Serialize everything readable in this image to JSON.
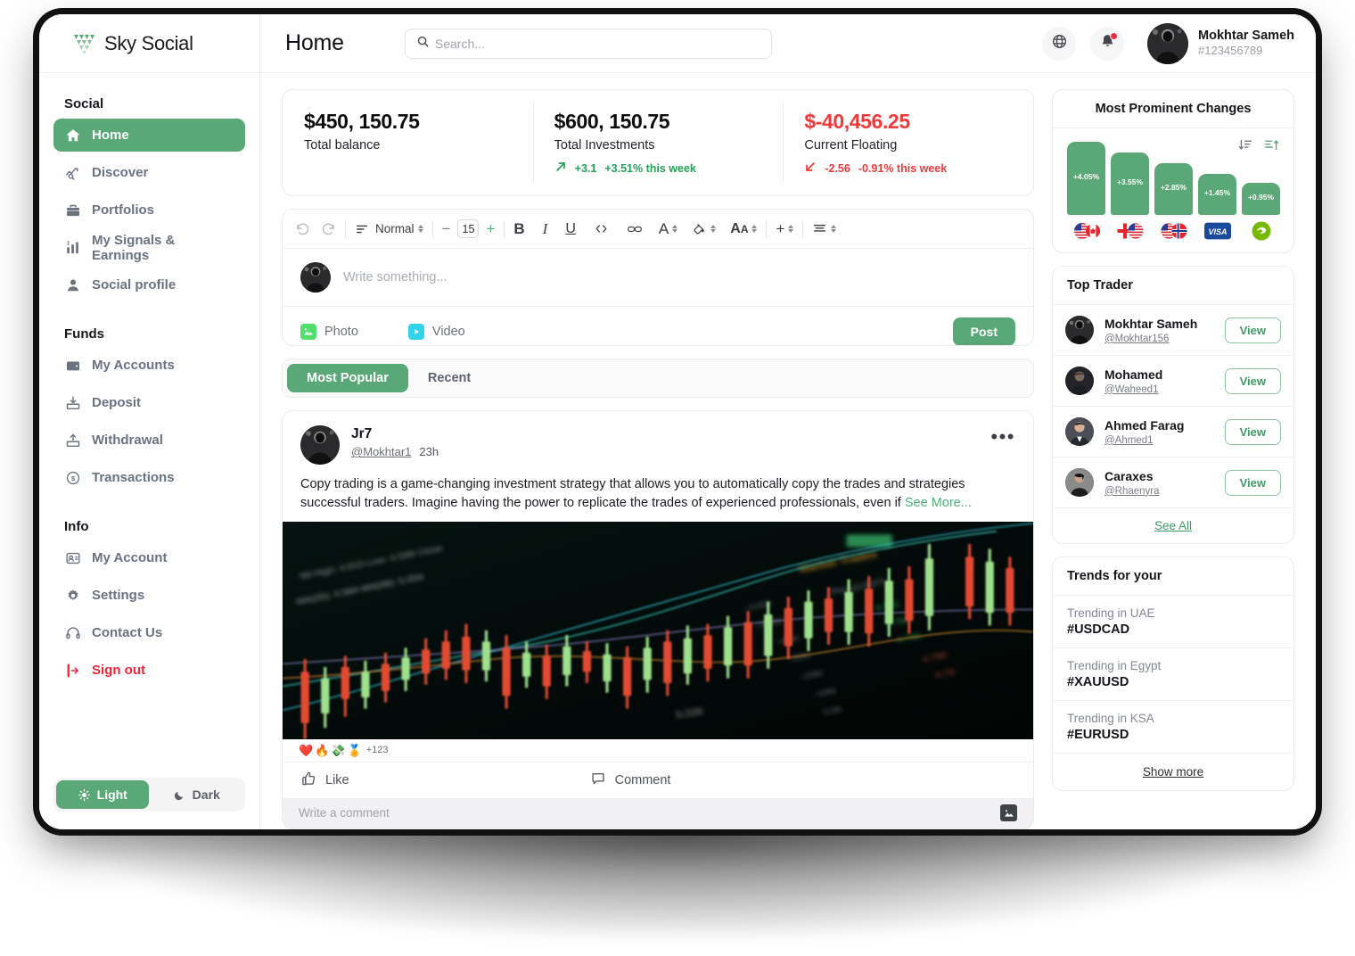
{
  "brand": {
    "name": "Sky Social"
  },
  "header": {
    "title": "Home",
    "search_placeholder": "Search...",
    "user_name": "Mokhtar Sameh",
    "user_id": "#123456789"
  },
  "sidebar": {
    "groups": [
      {
        "title": "Social",
        "items": [
          {
            "label": "Home",
            "icon": "home-icon",
            "active": true
          },
          {
            "label": "Discover",
            "icon": "discover-icon"
          },
          {
            "label": "Portfolios",
            "icon": "briefcase-icon"
          },
          {
            "label": "My Signals & Earnings",
            "icon": "bar-chart-icon"
          },
          {
            "label": "Social profile",
            "icon": "person-icon"
          }
        ]
      },
      {
        "title": "Funds",
        "items": [
          {
            "label": "My Accounts",
            "icon": "wallet-icon"
          },
          {
            "label": "Deposit",
            "icon": "deposit-icon"
          },
          {
            "label": "Withdrawal",
            "icon": "withdrawal-icon"
          },
          {
            "label": "Transactions",
            "icon": "transactions-icon"
          }
        ]
      },
      {
        "title": "Info",
        "items": [
          {
            "label": "My Account",
            "icon": "account-card-icon"
          },
          {
            "label": "Settings",
            "icon": "gear-icon"
          },
          {
            "label": "Contact Us",
            "icon": "headset-icon"
          },
          {
            "label": "Sign out",
            "icon": "sign-out-icon",
            "danger": true
          }
        ]
      }
    ],
    "theme": {
      "light_label": "Light",
      "dark_label": "Dark",
      "selected": "Light"
    }
  },
  "stats": [
    {
      "value": "$450, 150.75",
      "label": "Total balance",
      "negative": false,
      "delta": null
    },
    {
      "value": "$600, 150.75",
      "label": "Total Investments",
      "negative": false,
      "delta": {
        "direction": "up",
        "amount": "+3.1",
        "percent": "+3.51% this week"
      }
    },
    {
      "value": "$-40,456.25",
      "label": "Current Floating",
      "negative": true,
      "delta": {
        "direction": "down",
        "amount": "-2.56",
        "percent": "-0.91% this week"
      }
    }
  ],
  "editor": {
    "paragraph_style": "Normal",
    "font_size": "15",
    "tools": [
      "undo-icon",
      "redo-icon",
      "paragraph-icon",
      "decrease-font",
      "increase-font",
      "bold-icon",
      "italic-icon",
      "underline-icon",
      "code-icon",
      "link-icon",
      "text-color-icon",
      "fill-color-icon",
      "font-case-icon",
      "insert-icon",
      "align-icon"
    ]
  },
  "composer": {
    "placeholder": "Write something...",
    "photo_label": "Photo",
    "video_label": "Video",
    "post_label": "Post"
  },
  "tabs": [
    {
      "label": "Most Popular",
      "active": true
    },
    {
      "label": "Recent",
      "active": false
    }
  ],
  "post": {
    "author": "Jr7",
    "handle": "@Mokhtar1",
    "time": "23h",
    "text": "Copy trading is a game-changing investment strategy that allows you to automatically copy the trades and strategies successful traders. Imagine having the power to replicate the trades of experienced professionals, even if ",
    "see_more": "See More...",
    "image_alt": "candlestick-trading-chart-photo",
    "reactions": [
      "❤️",
      "🔥",
      "💸",
      "🏅"
    ],
    "reaction_count": "+123",
    "like_label": "Like",
    "comment_label": "Comment",
    "comment_placeholder": "Write a comment"
  },
  "changes_panel": {
    "title": "Most Prominent Changes",
    "sort_desc_icon": "sort-descending-icon",
    "sort_asc_icon": "sort-ascending-icon"
  },
  "chart_data": {
    "type": "bar",
    "title": "Most Prominent Changes",
    "categories": [
      "USD/CAD",
      "GBP/USD",
      "USD/NOK",
      "VISA",
      "NVIDIA"
    ],
    "values": [
      4.05,
      3.55,
      2.85,
      1.45,
      0.95
    ],
    "data_labels": [
      "+4.05%",
      "+3.55%",
      "+2.85%",
      "+1.45%",
      "+0.95%"
    ],
    "icons": [
      "flag-us-ca",
      "flag-gb-us",
      "flag-us-no",
      "visa-card",
      "nvidia-logo"
    ],
    "ylim": [
      0,
      4.5
    ],
    "xlabel": "",
    "ylabel": "",
    "grid": false,
    "legend": "none",
    "bar_color": "#5aa877"
  },
  "top_trader": {
    "title": "Top Trader",
    "see_all_label": "See All",
    "view_label": "View",
    "traders": [
      {
        "name": "Mokhtar Sameh",
        "handle": "@Mokhtar156"
      },
      {
        "name": "Mohamed",
        "handle": "@Waheed1"
      },
      {
        "name": "Ahmed Farag",
        "handle": "@Ahmed1"
      },
      {
        "name": "Caraxes",
        "handle": "@Rhaenyra"
      }
    ]
  },
  "trends": {
    "title": "Trends for your",
    "show_more_label": "Show more",
    "items": [
      {
        "region": "Trending in UAE",
        "tag": "#USDCAD"
      },
      {
        "region": "Trending in Egypt",
        "tag": "#XAUUSD"
      },
      {
        "region": "Trending in KSA",
        "tag": "#EURUSD"
      }
    ]
  },
  "colors": {
    "accent_green": "#5aa877",
    "danger_red": "#f0263c",
    "positive": "#23a25a",
    "negative": "#f03a3a"
  }
}
